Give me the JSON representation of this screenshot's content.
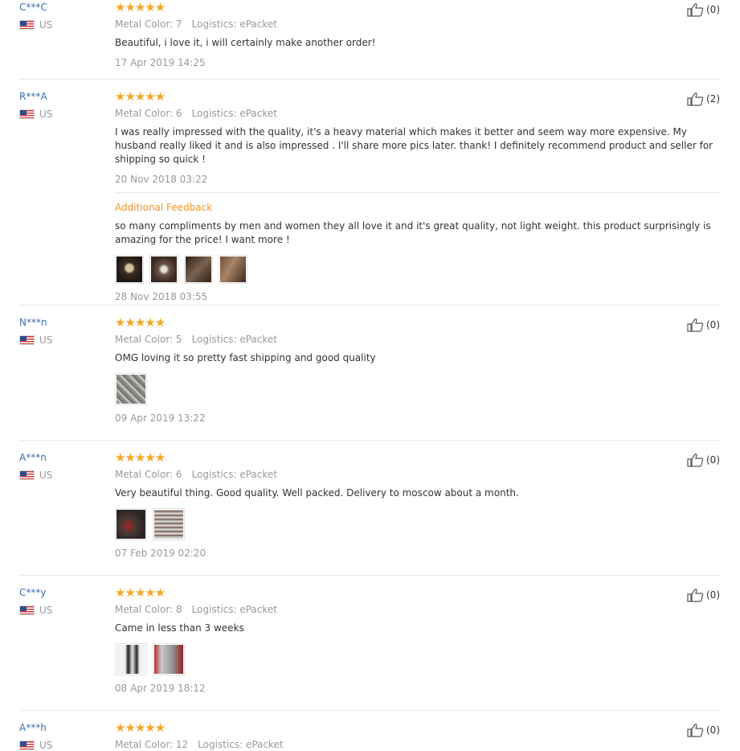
{
  "reviews": [
    {
      "user": "C***C",
      "country": "US",
      "stars": "★★★★★",
      "color": "Metal Color: 7",
      "logistics": "Logistics: ePacket",
      "text": "Beautiful, i love it, i will certainly make another order!",
      "date": "17 Apr 2019 14:25",
      "likes": "(0)"
    },
    {
      "user": "R***A",
      "country": "US",
      "stars": "★★★★★",
      "color": "Metal Color: 6",
      "logistics": "Logistics: ePacket",
      "text": "I was really impressed with the quality, it's a heavy material which makes it better and seem way more expensive. My husband really liked it and is also impressed . I'll share more pics later. thank! I definitely recommend product and seller for shipping so quick !",
      "date": "20 Nov 2018 03:22",
      "likes": "(2)",
      "additional": {
        "title": "Additional Feedback",
        "text": "so many compliments by men and women they all love it and it's great quality, not light weight. this product surprisingly is amazing for the price! I want more !",
        "date": "28 Nov 2018 03:55"
      }
    },
    {
      "user": "N***n",
      "country": "US",
      "stars": "★★★★★",
      "color": "Metal Color: 5",
      "logistics": "Logistics: ePacket",
      "text": "OMG loving it so pretty fast shipping and good quality",
      "date": "09 Apr 2019 13:22",
      "likes": "(0)"
    },
    {
      "user": "A***n",
      "country": "US",
      "stars": "★★★★★",
      "color": "Metal Color: 6",
      "logistics": "Logistics: ePacket",
      "text": "Very beautiful thing. Good quality. Well packed. Delivery to moscow about a month.",
      "date": "07 Feb 2019 02:20",
      "likes": "(0)"
    },
    {
      "user": "C***y",
      "country": "US",
      "stars": "★★★★★",
      "color": "Metal Color: 8",
      "logistics": "Logistics: ePacket",
      "text": "Came in less than 3 weeks",
      "date": "08 Apr 2019 18:12",
      "likes": "(0)"
    },
    {
      "user": "A***h",
      "country": "US",
      "stars": "★★★★★",
      "color": "Metal Color: 12",
      "logistics": "Logistics: ePacket",
      "likes": "(0)"
    }
  ],
  "colors": {
    "star": "#f5a623",
    "username": "#3a6db0",
    "additional": "#f29624",
    "meta": "#999999"
  }
}
